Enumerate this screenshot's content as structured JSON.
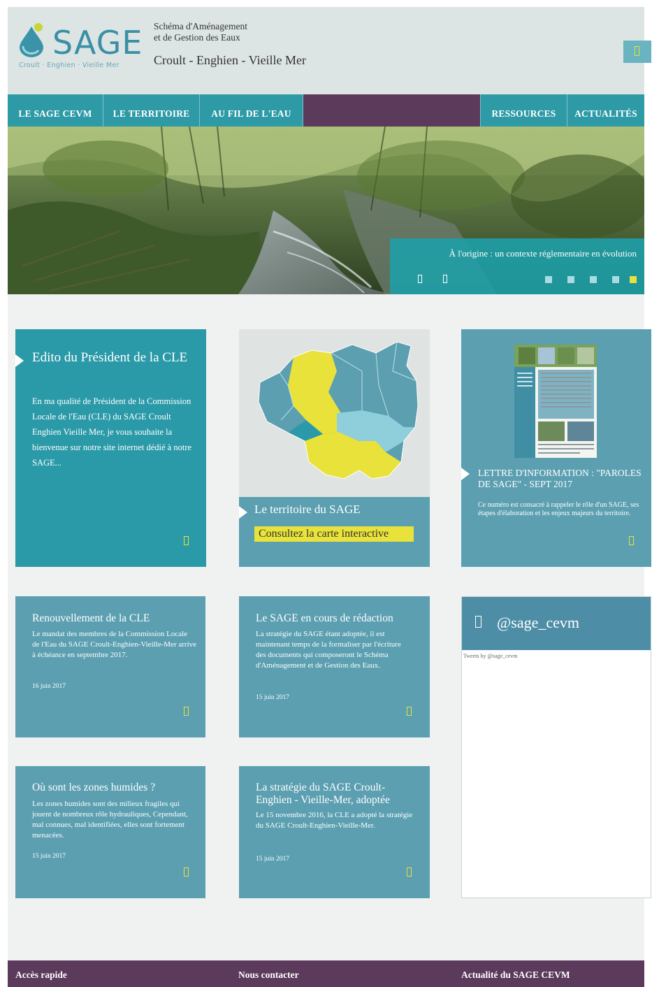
{
  "header": {
    "logo_word": "SAGE",
    "logo_tagline": "Croult · Enghien · Vieille Mer",
    "tagline_line1": "Schéma d'Aménagement",
    "tagline_line2": "et de Gestion des Eaux",
    "tagline_big": "Croult - Enghien - Vieille Mer",
    "menu_icon": "bars-icon"
  },
  "nav": {
    "items": [
      {
        "label": "LE SAGE CEVM"
      },
      {
        "label": "LE TERRITOIRE"
      },
      {
        "label": "AU FIL DE L'EAU"
      },
      {
        "label": "RESSOURCES"
      },
      {
        "label": "ACTUALITÉS"
      }
    ]
  },
  "hero": {
    "caption": "À l'origine : un contexte réglementaire en évolution",
    "slides_count": 5,
    "active_slide": 5
  },
  "cards": {
    "edito": {
      "title": "Edito du Président de la CLE",
      "text": "En ma qualité de Président de la Commission Locale de l'Eau (CLE) du SAGE Croult Enghien Vieille Mer, je vous souhaite la bienvenue sur notre site internet dédié à notre SAGE..."
    },
    "territoire": {
      "title": "Le territoire du SAGE",
      "cta": "Consultez la carte interactive"
    },
    "lettre": {
      "title": "LETTRE D'INFORMATION : \"PAROLES DE SAGE\" - SEPT 2017",
      "text": "Ce numéro est consacré à rappeler le rôle d'un SAGE, ses étapes d'élaboration et les enjeux majeurs du territoire."
    },
    "news": [
      {
        "title": "Renouvellement de la CLE",
        "text": "Le mandat des membres de la Commission Locale de l'Eau du SAGE Croult-Enghien-Vieille-Mer arrive à échéance en septembre 2017.",
        "date": "16 juin 2017"
      },
      {
        "title": "Le SAGE en cours de rédaction",
        "text": "La stratégie du SAGE étant adoptée, il est maintenant temps de la formaliser par l'écriture des documents qui composeront le Schéma d'Aménagement et de Gestion des Eaux.",
        "date": "15 juin 2017"
      },
      {
        "title": "Où sont les zones humides ?",
        "text": "Les zones humides sont des milieux fragiles qui jouent de nombreux rôle hydrauliques, Cependant, mal connues, mal identifiées, elles sont fortement menacées.",
        "date": "15 juin 2017"
      },
      {
        "title": "La stratégie du SAGE Croult-Enghien - Vieille-Mer, adoptée",
        "text": "Le 15 novembre 2016, la CLE a adopté la stratégie du SAGE Croult-Enghien-Vieille-Mer.",
        "date": "15 juin 2017"
      }
    ],
    "twitter": {
      "handle": "@sage_cevm",
      "embed_label": "Tweets by @sage_cevm"
    }
  },
  "footer": {
    "links": [
      "Accès rapide",
      "Nous contacter",
      "Actualité du SAGE CEVM"
    ]
  },
  "colors": {
    "teal": "#2b9aa8",
    "card_blue": "#5b9fb1",
    "plum": "#5b3a5b",
    "accent_yellow": "#e8e23a"
  }
}
